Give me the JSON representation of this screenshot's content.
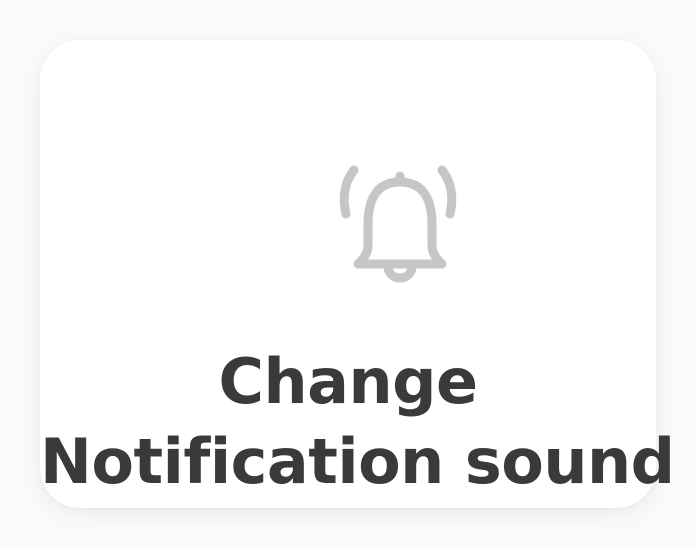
{
  "tile": {
    "line1": "Change",
    "line2": "Notification sound",
    "icon": "bell-ringing-icon",
    "icon_color": "#c6c6c6",
    "text_color": "#3a3a3a"
  }
}
